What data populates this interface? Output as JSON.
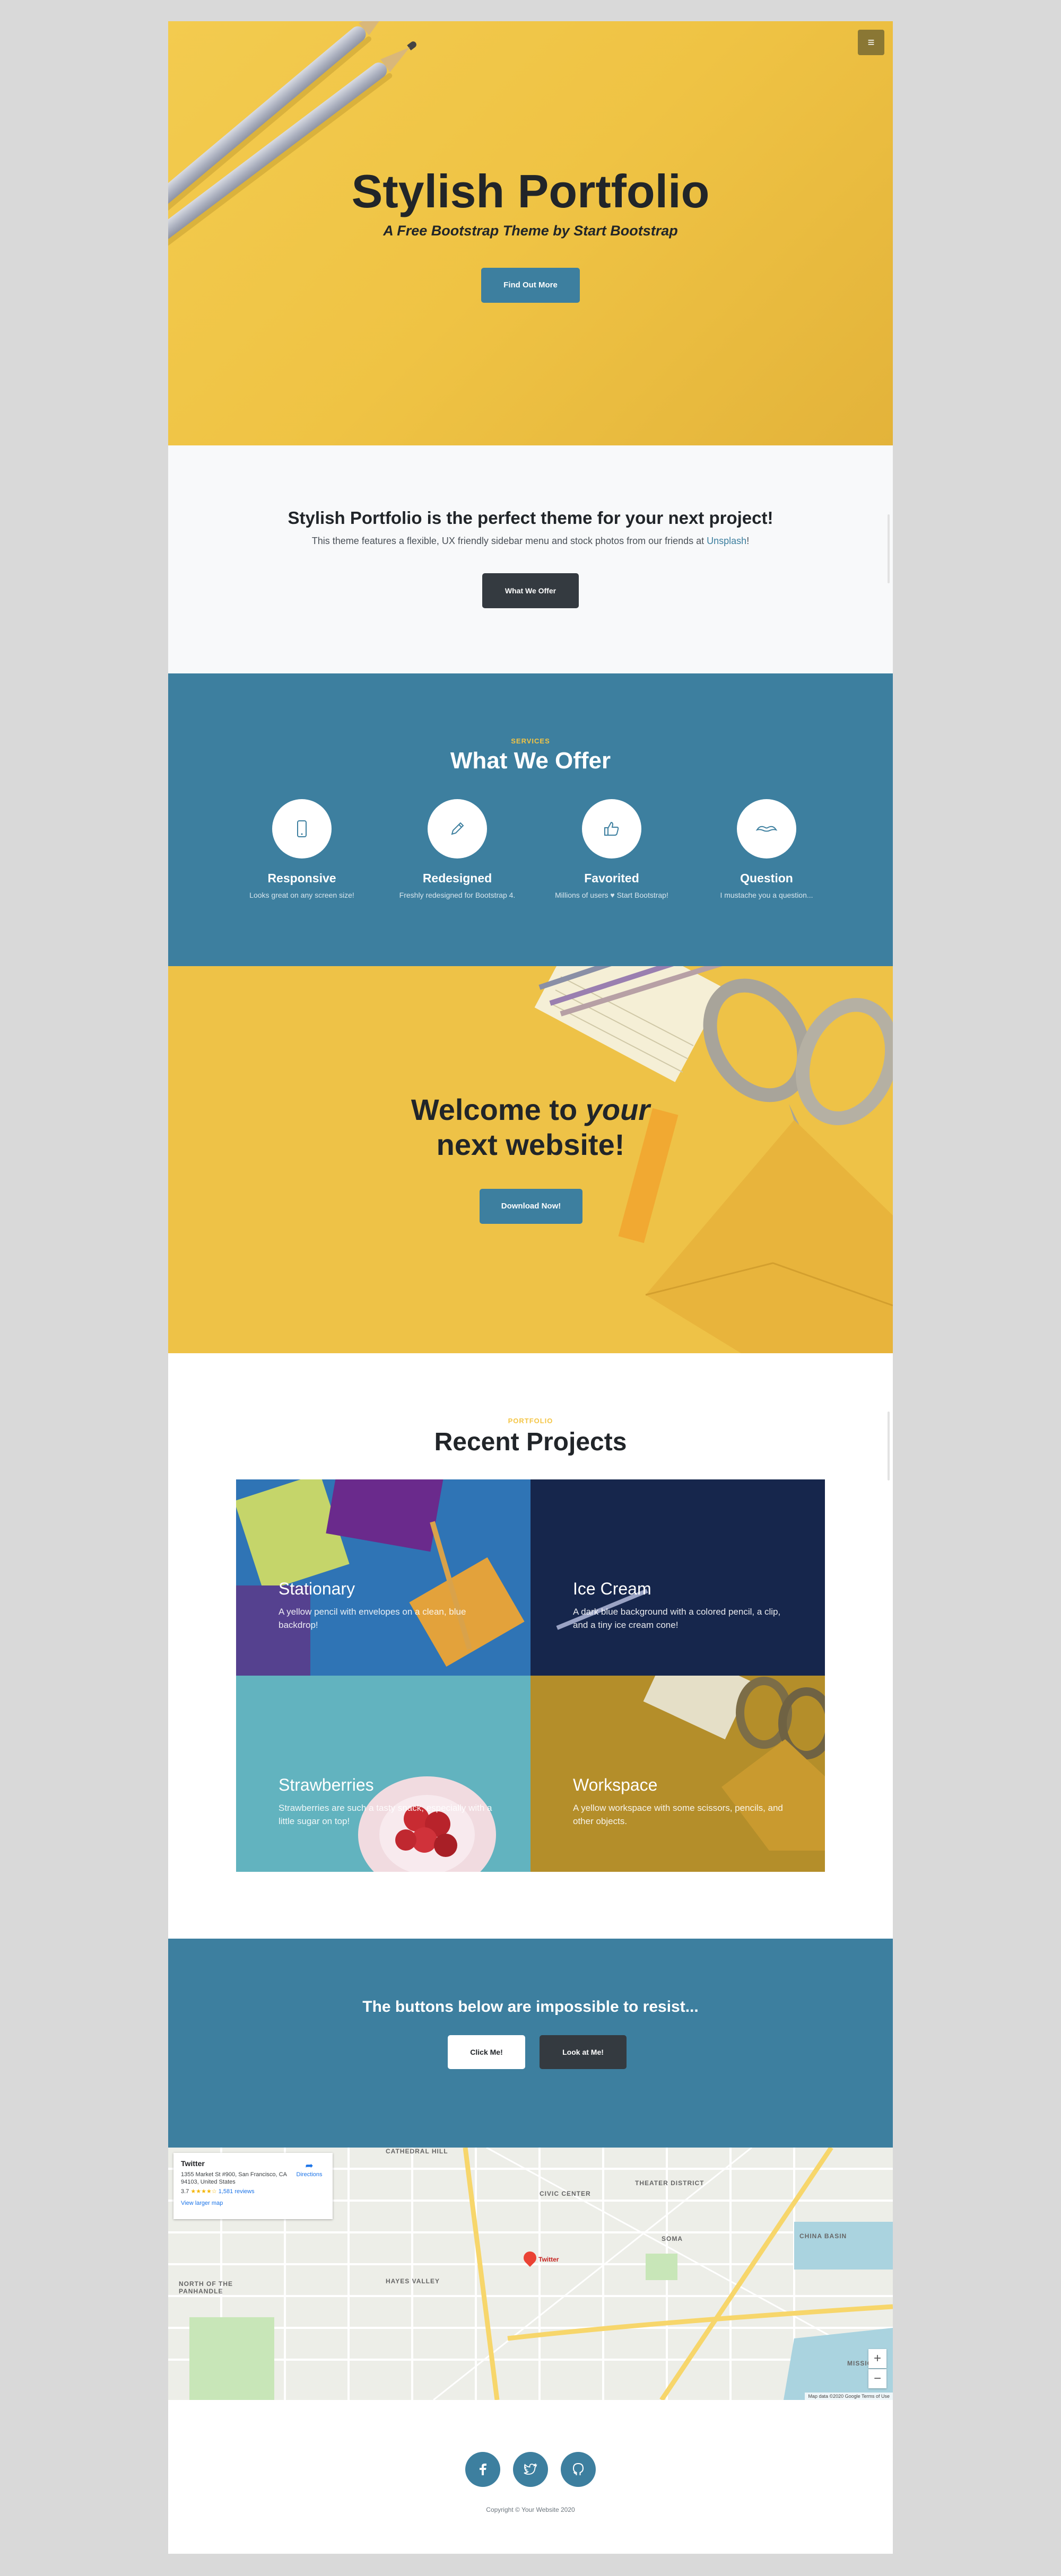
{
  "hero": {
    "title": "Stylish Portfolio",
    "subtitle": "A Free Bootstrap Theme by Start Bootstrap",
    "button": "Find Out More",
    "menu_icon": "bars-icon"
  },
  "about": {
    "heading": "Stylish Portfolio is the perfect theme for your next project!",
    "text": "This theme features a flexible, UX friendly sidebar menu and stock photos from our friends at ",
    "link": "Unsplash",
    "text_end": "!",
    "button": "What We Offer"
  },
  "services": {
    "eyebrow": "SERVICES",
    "heading": "What We Offer",
    "items": [
      {
        "icon": "mobile-phone-icon",
        "title": "Responsive",
        "desc": "Looks great on any screen size!"
      },
      {
        "icon": "pencil-icon",
        "title": "Redesigned",
        "desc": "Freshly redesigned for Bootstrap 4."
      },
      {
        "icon": "thumbs-up-icon",
        "title": "Favorited",
        "desc_a": "Millions of users ",
        "desc_b": " Start Bootstrap!"
      },
      {
        "icon": "mustache-icon",
        "title": "Question",
        "desc": "I mustache you a question..."
      }
    ]
  },
  "callout": {
    "line1a": "Welcome to ",
    "line1b": "your",
    "line2": "next website!",
    "button": "Download Now!"
  },
  "portfolio": {
    "eyebrow": "PORTFOLIO",
    "heading": "Recent Projects",
    "items": [
      {
        "title": "Stationary",
        "desc": "A yellow pencil with envelopes on a clean, blue backdrop!"
      },
      {
        "title": "Ice Cream",
        "desc": "A dark blue background with a colored pencil, a clip, and a tiny ice cream cone!"
      },
      {
        "title": "Strawberries",
        "desc": "Strawberries are such a tasty snack, especially with a little sugar on top!"
      },
      {
        "title": "Workspace",
        "desc": "A yellow workspace with some scissors, pencils, and other objects."
      }
    ]
  },
  "cta": {
    "heading": "The buttons below are impossible to resist...",
    "button1": "Click Me!",
    "button2": "Look at Me!"
  },
  "map": {
    "card_title": "Twitter",
    "card_address": "1355 Market St #900, San Francisco, CA 94103, United States",
    "rating": "3.7",
    "stars": "★★★★☆",
    "reviews": "1,581 reviews",
    "larger_map": "View larger map",
    "directions": "Directions",
    "pin_label": "Twitter",
    "labels": [
      "CATHEDRAL HILL",
      "CIVIC CENTER",
      "THEATER DISTRICT",
      "SOMA",
      "CHINA BASIN",
      "HAYES VALLEY",
      "NORTH OF THE PANHANDLE",
      "MISSION"
    ],
    "footer": "Map data ©2020 Google   Terms of Use"
  },
  "footer": {
    "social": [
      "facebook-icon",
      "twitter-icon",
      "github-icon"
    ],
    "copyright": "Copyright © Your Website 2020"
  },
  "colors": {
    "primary": "#3d7f9f",
    "accent": "#f4c544",
    "dark": "#343a40",
    "hero": "#f3cb4f"
  }
}
